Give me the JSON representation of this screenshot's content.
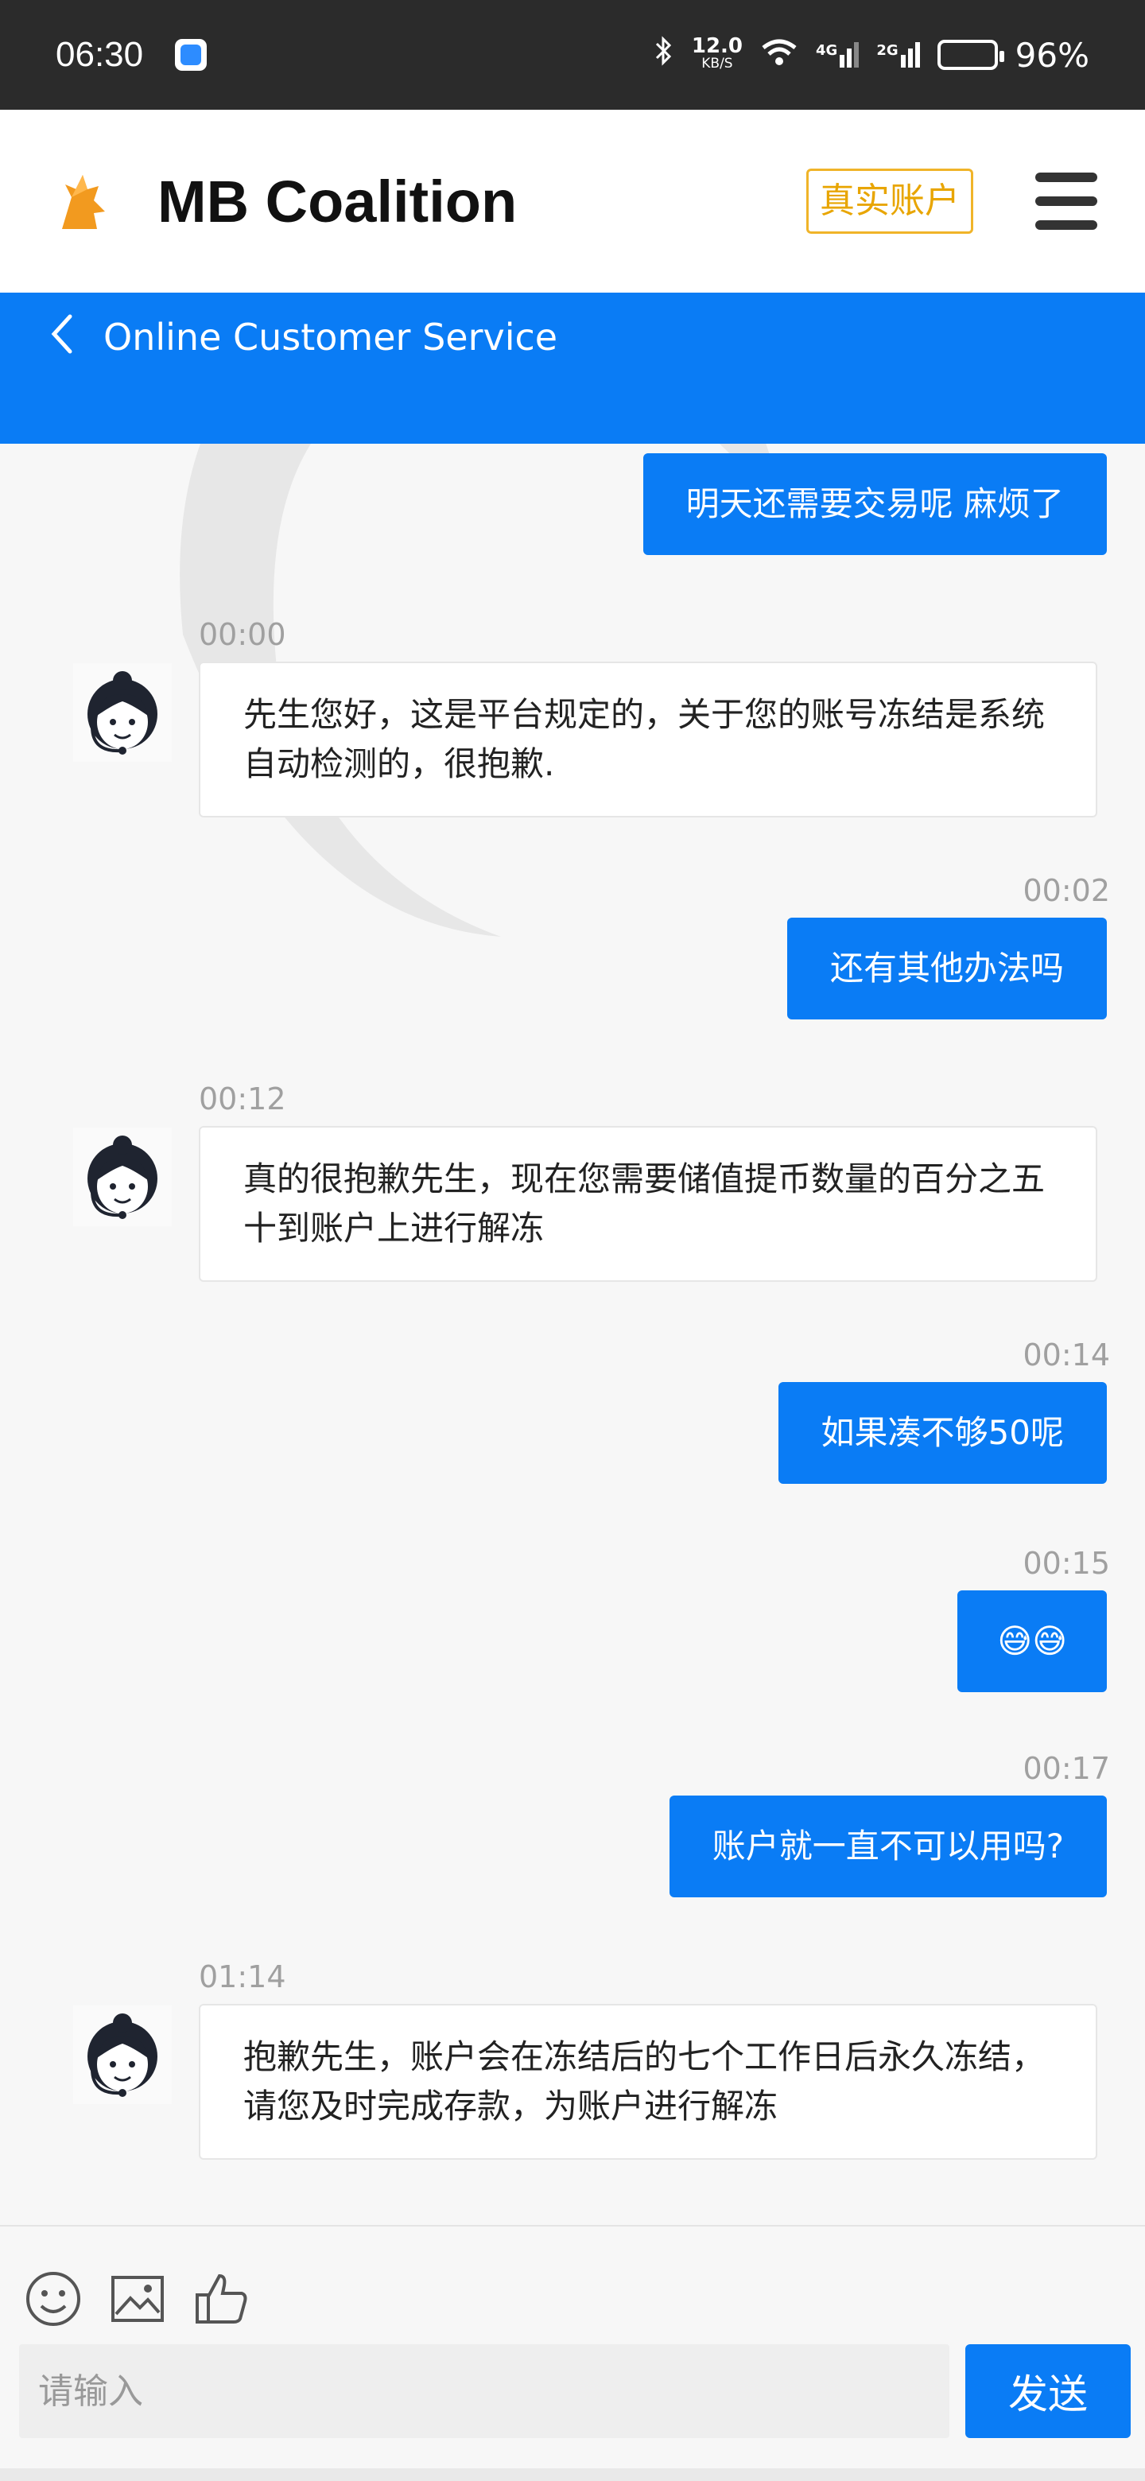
{
  "status_bar": {
    "time": "06:30",
    "speed_top": "12.0",
    "speed_bottom": "KB/S",
    "signal_1": "4G",
    "signal_2": "2G",
    "battery": "96%"
  },
  "header": {
    "brand": "MB Coalition",
    "account_badge": "真实账户",
    "accent_color": "#e8a500"
  },
  "nav": {
    "title": "Online Customer Service",
    "color": "#0a7cf5"
  },
  "messages": [
    {
      "side": "out",
      "time": "",
      "text": "明天还需要交易呢 麻烦了"
    },
    {
      "side": "in",
      "time": "00:00",
      "text": "先生您好，这是平台规定的，关于您的账号冻结是系统自动检测的，很抱歉."
    },
    {
      "side": "out",
      "time": "00:02",
      "text": "还有其他办法吗"
    },
    {
      "side": "in",
      "time": "00:12",
      "text": "真的很抱歉先生，现在您需要储值提币数量的百分之五十到账户上进行解冻"
    },
    {
      "side": "out",
      "time": "00:14",
      "text": "如果凑不够50呢"
    },
    {
      "side": "out",
      "time": "00:15",
      "text": "😅😅"
    },
    {
      "side": "out",
      "time": "00:17",
      "text": "账户就一直不可以用吗?"
    },
    {
      "side": "in",
      "time": "01:14",
      "text": "抱歉先生，账户会在冻结后的七个工作日后永久冻结，请您及时完成存款，为账户进行解冻"
    }
  ],
  "footer": {
    "tools": [
      "smiley-icon",
      "image-icon",
      "thumbs-up-icon"
    ],
    "input_placeholder": "请输入",
    "send_label": "发送"
  }
}
